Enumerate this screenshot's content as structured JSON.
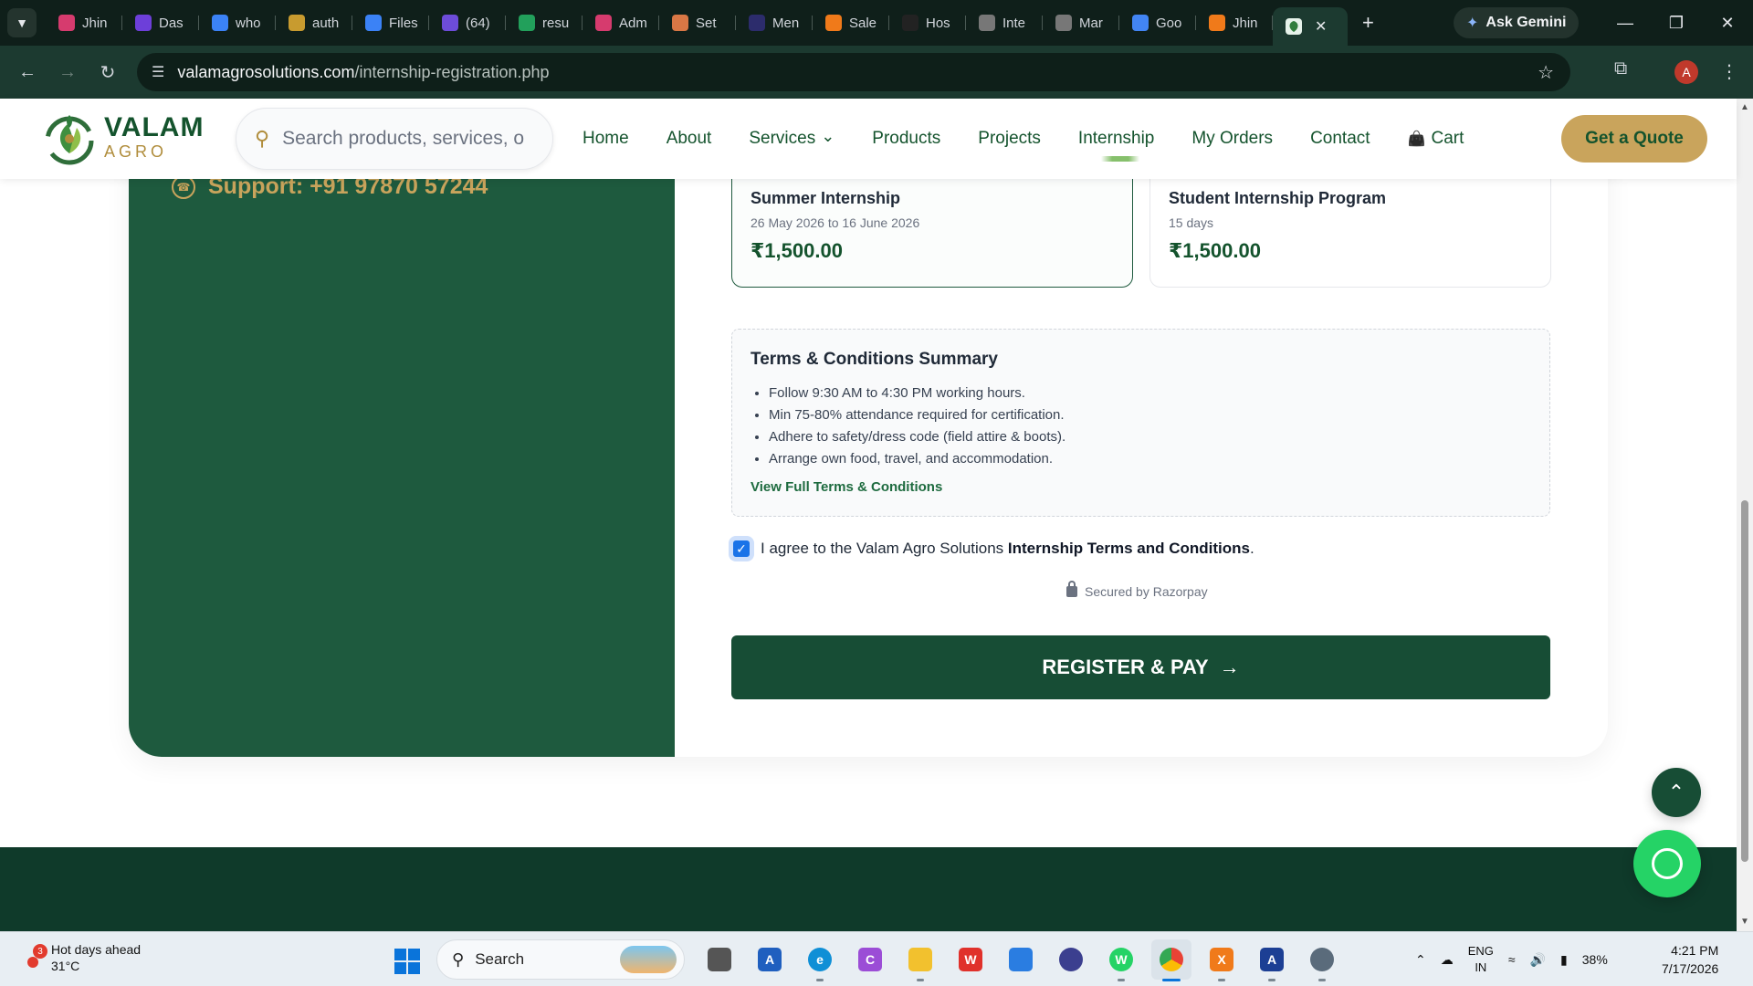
{
  "browser": {
    "tabs": [
      {
        "label": "Jhin",
        "icon": "web-icon",
        "color": "#d63b6e"
      },
      {
        "label": "Das",
        "icon": "h-logo-icon",
        "color": "#6d3fd9"
      },
      {
        "label": "who",
        "icon": "globe-icon",
        "color": "#3b82f6"
      },
      {
        "label": "auth",
        "icon": "chart-icon",
        "color": "#c89b2f"
      },
      {
        "label": "Files",
        "icon": "globe-icon",
        "color": "#3b82f6"
      },
      {
        "label": "(64)",
        "icon": "mail-icon",
        "color": "#6d4cd9"
      },
      {
        "label": "resu",
        "icon": "arrow-icon",
        "color": "#22a05b"
      },
      {
        "label": "Adm",
        "icon": "web-icon",
        "color": "#d63b6e"
      },
      {
        "label": "Set",
        "icon": "spark-icon",
        "color": "#d97745"
      },
      {
        "label": "Men",
        "icon": "dark-square-icon",
        "color": "#2c2c6c"
      },
      {
        "label": "Sale",
        "icon": "xampp-icon",
        "color": "#f07a1a"
      },
      {
        "label": "Hos",
        "icon": "openai-icon",
        "color": "#222222"
      },
      {
        "label": "Inte",
        "icon": "globe-icon",
        "color": "#777777"
      },
      {
        "label": "Mar",
        "icon": "globe-icon",
        "color": "#777777"
      },
      {
        "label": "Goo",
        "icon": "google-icon",
        "color": "#4285f4"
      },
      {
        "label": "Jhin",
        "icon": "xampp-icon",
        "color": "#f07a1a"
      }
    ],
    "active_tab_icon": "valam-favicon",
    "ask_gemini": "Ask Gemini",
    "url_domain": "valamagrosolutions.com",
    "url_path": "/internship-registration.php",
    "profile_initial": "A"
  },
  "header": {
    "logo_valam": "VALAM",
    "logo_agro": "AGRO",
    "search_placeholder": "Search products, services, o",
    "nav": [
      "Home",
      "About",
      "Services",
      "Products",
      "Projects",
      "Internship",
      "My Orders",
      "Contact",
      "Cart"
    ],
    "active_nav": "Internship",
    "quote_button": "Get a Quote"
  },
  "sidebar": {
    "support": "Support: +91 97870 57244"
  },
  "programs": [
    {
      "title": "Summer Internship",
      "subtitle": "26 May 2026 to 16 June 2026",
      "price": "₹1,500.00",
      "selected": true
    },
    {
      "title": "Student Internship Program",
      "subtitle": "15 days",
      "price": "₹1,500.00",
      "selected": false
    }
  ],
  "terms": {
    "title": "Terms & Conditions Summary",
    "items": [
      "Follow 9:30 AM to 4:30 PM working hours.",
      "Min 75-80% attendance required for certification.",
      "Adhere to safety/dress code (field attire & boots).",
      "Arrange own food, travel, and accommodation."
    ],
    "link": "View Full Terms & Conditions"
  },
  "agreement": {
    "prefix": "I agree to the Valam Agro Solutions ",
    "bold": "Internship Terms and Conditions",
    "suffix": ".",
    "checked": true
  },
  "secured_by": "Secured by Razorpay",
  "register_button": "REGISTER & PAY",
  "colors": {
    "primary_green": "#174d35",
    "gold": "#c9a45c",
    "whatsapp": "#25d366"
  },
  "taskbar": {
    "weather_title": "Hot days ahead",
    "weather_temp": "31°C",
    "weather_badge": "3",
    "search_label": "Search",
    "apps": [
      {
        "name": "task-view",
        "glyph": "",
        "color": "#555555",
        "running": false
      },
      {
        "name": "azure",
        "glyph": "A",
        "color": "#1f5fbf",
        "running": false
      },
      {
        "name": "edge",
        "glyph": "e",
        "color": "#0f8fd6",
        "running": true
      },
      {
        "name": "copilot",
        "glyph": "C",
        "color": "#9b4dd6",
        "running": false
      },
      {
        "name": "file-explorer",
        "glyph": "",
        "color": "#f2c12e",
        "running": true
      },
      {
        "name": "wps-office",
        "glyph": "W",
        "color": "#e0312b",
        "running": false
      },
      {
        "name": "ms-store",
        "glyph": "",
        "color": "#2a7de1",
        "running": false
      },
      {
        "name": "eclipse",
        "glyph": "",
        "color": "#3b3f8f",
        "running": false
      },
      {
        "name": "whatsapp",
        "glyph": "W",
        "color": "#25d366",
        "running": true
      },
      {
        "name": "chrome",
        "glyph": "",
        "color": "#e94235",
        "running": true,
        "focused": true
      },
      {
        "name": "xampp",
        "glyph": "X",
        "color": "#f07a1a",
        "running": true
      },
      {
        "name": "vs-app",
        "glyph": "A",
        "color": "#1c3f94",
        "running": true
      },
      {
        "name": "settings",
        "glyph": "",
        "color": "#5a6b7b",
        "running": true
      }
    ],
    "lang_top": "ENG",
    "lang_bottom": "IN",
    "battery": "38%",
    "time": "4:21 PM",
    "date": "7/17/2026"
  }
}
